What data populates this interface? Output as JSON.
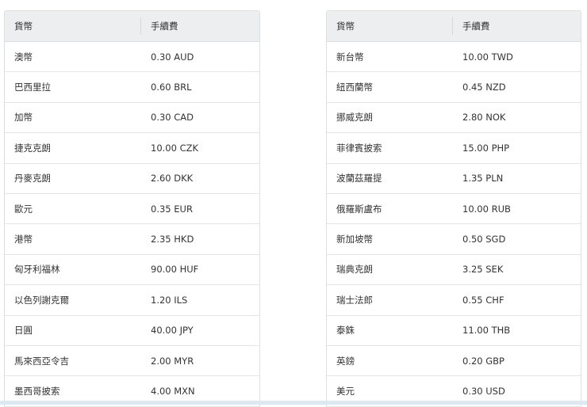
{
  "headers": {
    "currency": "貨幣",
    "fee": "手續費"
  },
  "left": [
    {
      "name": "澳幣",
      "fee": "0.30 AUD"
    },
    {
      "name": "巴西里拉",
      "fee": "0.60 BRL"
    },
    {
      "name": "加幣",
      "fee": "0.30 CAD"
    },
    {
      "name": "捷克克朗",
      "fee": "10.00 CZK"
    },
    {
      "name": "丹麥克朗",
      "fee": "2.60 DKK"
    },
    {
      "name": "歐元",
      "fee": "0.35 EUR"
    },
    {
      "name": "港幣",
      "fee": "2.35 HKD"
    },
    {
      "name": "匈牙利福林",
      "fee": "90.00 HUF"
    },
    {
      "name": "以色列謝克爾",
      "fee": "1.20 ILS"
    },
    {
      "name": "日圓",
      "fee": "40.00 JPY"
    },
    {
      "name": "馬來西亞令吉",
      "fee": "2.00 MYR"
    },
    {
      "name": "墨西哥披索",
      "fee": "4.00 MXN"
    }
  ],
  "right": [
    {
      "name": "新台幣",
      "fee": "10.00 TWD"
    },
    {
      "name": "紐西蘭幣",
      "fee": "0.45 NZD"
    },
    {
      "name": "挪威克朗",
      "fee": "2.80 NOK"
    },
    {
      "name": "菲律賓披索",
      "fee": "15.00 PHP"
    },
    {
      "name": "波蘭茲羅提",
      "fee": "1.35 PLN"
    },
    {
      "name": "俄羅斯盧布",
      "fee": "10.00 RUB"
    },
    {
      "name": "新加坡幣",
      "fee": "0.50 SGD"
    },
    {
      "name": "瑞典克朗",
      "fee": "3.25 SEK"
    },
    {
      "name": "瑞士法郎",
      "fee": "0.55 CHF"
    },
    {
      "name": "泰銖",
      "fee": "11.00 THB"
    },
    {
      "name": "英鎊",
      "fee": "0.20 GBP"
    },
    {
      "name": "美元",
      "fee": "0.30 USD"
    }
  ]
}
